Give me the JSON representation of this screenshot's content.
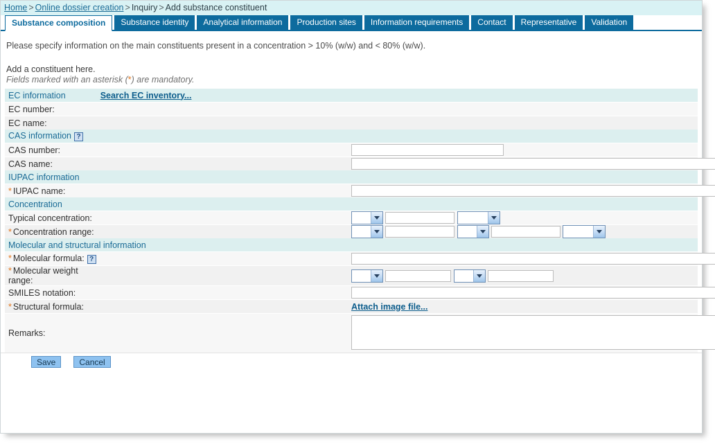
{
  "breadcrumb": {
    "items": [
      {
        "label": "Home",
        "link": true
      },
      {
        "label": "Online dossier creation",
        "link": true
      },
      {
        "label": "Inquiry",
        "link": false
      },
      {
        "label": "Add substance constituent",
        "link": false
      }
    ],
    "separator": ">"
  },
  "tabs": [
    {
      "label": "Substance composition",
      "active": true
    },
    {
      "label": "Substance identity",
      "active": false
    },
    {
      "label": "Analytical information",
      "active": false
    },
    {
      "label": "Production sites",
      "active": false
    },
    {
      "label": "Information requirements",
      "active": false
    },
    {
      "label": "Contact",
      "active": false
    },
    {
      "label": "Representative",
      "active": false
    },
    {
      "label": "Validation",
      "active": false
    }
  ],
  "intro": "Please specify information on the main constituents present in a concentration > 10% (w/w) and < 80% (w/w).",
  "add_line": "Add a constituent here.",
  "mandatory_note_pre": "Fields marked with an asterisk (",
  "mandatory_note_ast": "*",
  "mandatory_note_post": ") are mandatory.",
  "sections": {
    "ec": {
      "title": "EC information",
      "search_link": "Search EC inventory...",
      "ec_number_label": "EC number:",
      "ec_number_value": "",
      "ec_name_label": "EC name:",
      "ec_name_value": ""
    },
    "cas": {
      "title": "CAS information",
      "help_icon": "?",
      "number_label": "CAS number:",
      "number_value": "",
      "name_label": "CAS name:",
      "name_value": ""
    },
    "iupac": {
      "title": "IUPAC information",
      "name_label": "IUPAC name:",
      "name_value": "",
      "name_required": "*"
    },
    "concentration": {
      "title": "Concentration",
      "typical_label": "Typical concentration:",
      "typical_op_value": "",
      "typical_value": "",
      "typical_unit_value": "",
      "range_label": "Concentration range:",
      "range_required": "*",
      "range_op1_value": "",
      "range_value1": "",
      "range_op2_value": "",
      "range_value2": "",
      "range_unit_value": ""
    },
    "molecular": {
      "title": "Molecular and structural information",
      "formula_label": "Molecular formula:",
      "formula_required": "*",
      "formula_help": "?",
      "formula_value": "",
      "weight_label_line1": "Molecular weight",
      "weight_label_line2": "range:",
      "weight_required": "*",
      "weight_op1_value": "",
      "weight_value1": "",
      "weight_op2_value": "",
      "weight_value2": "",
      "smiles_label": "SMILES notation:",
      "smiles_value": "",
      "structural_label": "Structural formula:",
      "structural_required": "*",
      "attach_link": "Attach image file..."
    },
    "remarks": {
      "label": "Remarks:",
      "value": ""
    }
  },
  "footer": {
    "save_label": "Save",
    "cancel_label": "Cancel"
  },
  "colors": {
    "tab_blue": "#0d6b9e",
    "breadcrumb_bg": "#d9f2f4",
    "section_bg": "#dcefef",
    "section_text": "#1a6b96",
    "asterisk": "#e2761b",
    "button_bg": "#8ec2f0"
  }
}
